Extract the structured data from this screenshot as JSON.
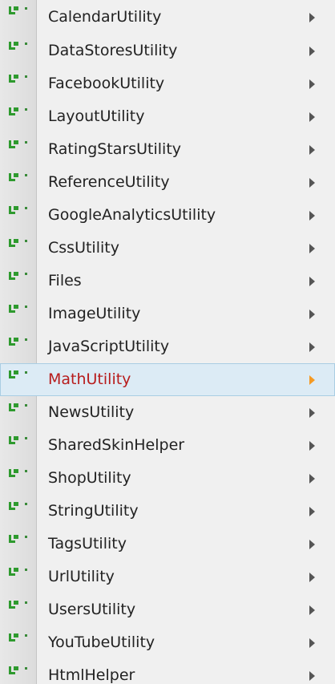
{
  "menu": {
    "items": [
      {
        "label": "CalendarUtility",
        "icon": "class-icon"
      },
      {
        "label": "DataStoresUtility",
        "icon": "class-icon"
      },
      {
        "label": "FacebookUtility",
        "icon": "class-icon"
      },
      {
        "label": "LayoutUtility",
        "icon": "class-icon"
      },
      {
        "label": "RatingStarsUtility",
        "icon": "class-icon"
      },
      {
        "label": "ReferenceUtility",
        "icon": "class-icon"
      },
      {
        "label": "GoogleAnalyticsUtility",
        "icon": "class-icon"
      },
      {
        "label": "CssUtility",
        "icon": "class-icon"
      },
      {
        "label": "Files",
        "icon": "class-icon"
      },
      {
        "label": "ImageUtility",
        "icon": "class-icon"
      },
      {
        "label": "JavaScriptUtility",
        "icon": "class-icon"
      },
      {
        "label": "MathUtility",
        "icon": "class-icon",
        "highlighted": true
      },
      {
        "label": "NewsUtility",
        "icon": "class-icon"
      },
      {
        "label": "SharedSkinHelper",
        "icon": "class-icon"
      },
      {
        "label": "ShopUtility",
        "icon": "class-icon"
      },
      {
        "label": "StringUtility",
        "icon": "class-icon"
      },
      {
        "label": "TagsUtility",
        "icon": "class-icon"
      },
      {
        "label": "UrlUtility",
        "icon": "class-icon"
      },
      {
        "label": "UsersUtility",
        "icon": "class-icon"
      },
      {
        "label": "YouTubeUtility",
        "icon": "class-icon"
      },
      {
        "label": "HtmlHelper",
        "icon": "class-icon"
      }
    ],
    "colors": {
      "text": "#222222",
      "highlight_text": "#b71c1c",
      "highlight_bg": "#dcebf5",
      "highlight_border": "#a9cde3",
      "icon_green": "#2e9a2e",
      "arrow": "#555555",
      "highlight_arrow": "#f59a23"
    }
  }
}
